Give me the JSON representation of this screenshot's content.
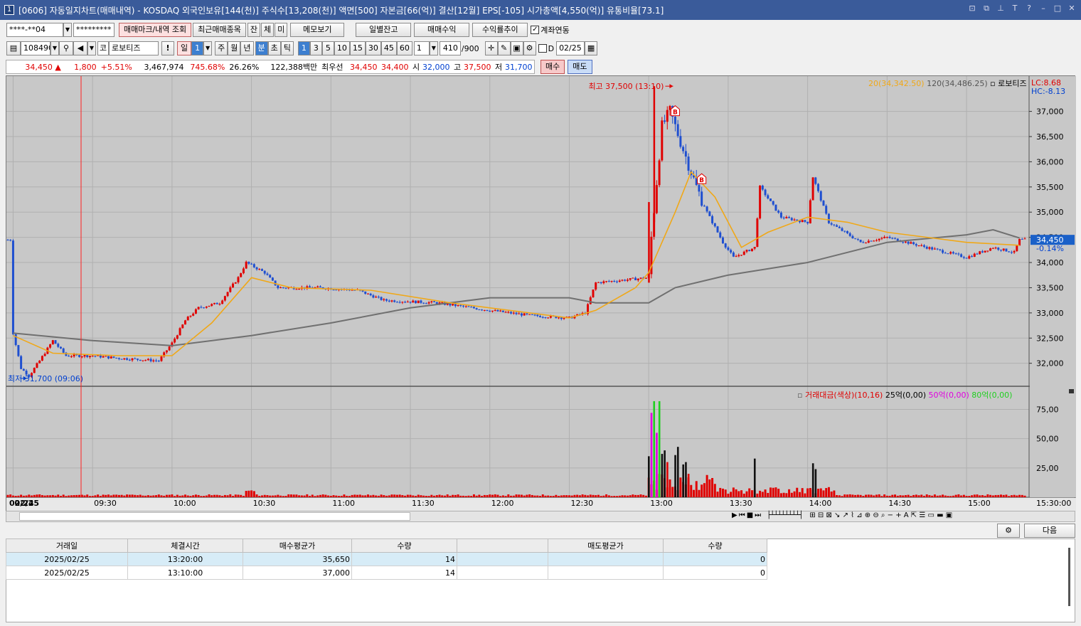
{
  "window": {
    "title": "[0606] 자동일지차트(매매내역) - KOSDAQ 외국인보유[144(천)] 주식수[13,208(천)] 액면[500] 자본금[66(억)] 결산[12월] EPS[-105] 시가총액[4,550(억)] 유통비율[73.1]",
    "app_number": "1"
  },
  "toolbar1": {
    "account": "****-**04",
    "password": "*********",
    "trade_mark_button": "매매마크/내역 조회",
    "recent_button": "최근매매종목",
    "jan": "잔",
    "che": "체",
    "mi": "미",
    "memo_button": "메모보기",
    "daily_balance_button": "일별잔고",
    "trade_profit_button": "매매수익",
    "profit_rate_button": "수익률추이",
    "account_link_label": "계좌연동"
  },
  "toolbar2": {
    "code": "108490",
    "name_prefix": "코",
    "name": "로보티즈",
    "excl": "!",
    "day": "일",
    "period_value": "1",
    "week": "주",
    "month": "월",
    "year": "년",
    "minute": "분",
    "second": "초",
    "tick": "틱",
    "intervals": [
      "1",
      "3",
      "5",
      "10",
      "15",
      "30",
      "45",
      "60"
    ],
    "interval_input": "1",
    "count": "410",
    "count_max": "/900",
    "d_label": "D",
    "date": "02/25"
  },
  "ticker": {
    "price": "34,450",
    "arrow": "▲",
    "change": "1,800",
    "change_pct": "+5.51%",
    "volume": "3,467,974",
    "volume_ratio": "745.68%",
    "turnover": "26.26%",
    "amount": "122,388백만",
    "best_label": "최우선",
    "best_ask": "34,450",
    "best_bid": "34,400",
    "open_label": "시",
    "open": "32,000",
    "high_label": "고",
    "high": "37,500",
    "low_label": "저",
    "low": "31,700",
    "buy_button": "매수",
    "sell_button": "매도"
  },
  "chart_data": [
    {
      "type": "candlestick",
      "title": "로보티즈",
      "legend": [
        "20(34,342.50)",
        "120(34,486.25)",
        "로보티즈"
      ],
      "corner_labels": [
        "LC:8.68",
        "HC:-8.13"
      ],
      "y_ticks": [
        "37,000",
        "36,500",
        "36,000",
        "35,500",
        "35,000",
        "34,500",
        "34,000",
        "33,500",
        "33,000",
        "32,500",
        "32,000"
      ],
      "ylim": [
        31700,
        37500
      ],
      "current_price_label": "34,450",
      "current_change_label": "-0.14%",
      "high_annotation": "최고 37,500 (13:10)",
      "low_annotation": "최저 31,700 (09:06)",
      "buy_markers": [
        "B",
        "B"
      ],
      "x_ticks": [
        "02/24",
        "02/25",
        "09:30",
        "10:00",
        "10:30",
        "11:00",
        "11:30",
        "12:00",
        "12:30",
        "13:00",
        "13:30",
        "14:00",
        "14:30",
        "15:00",
        "15:30:00"
      ],
      "price_path": [
        [
          "09:00",
          32600
        ],
        [
          "09:03",
          31900
        ],
        [
          "09:06",
          31750
        ],
        [
          "09:10",
          32050
        ],
        [
          "09:15",
          32450
        ],
        [
          "09:20",
          32150
        ],
        [
          "09:30",
          32150
        ],
        [
          "09:40",
          32100
        ],
        [
          "09:55",
          32050
        ],
        [
          "10:00",
          32400
        ],
        [
          "10:05",
          32850
        ],
        [
          "10:10",
          33100
        ],
        [
          "10:18",
          33200
        ],
        [
          "10:25",
          33700
        ],
        [
          "10:28",
          34000
        ],
        [
          "10:35",
          33800
        ],
        [
          "10:40",
          33500
        ],
        [
          "10:55",
          33500
        ],
        [
          "11:10",
          33450
        ],
        [
          "11:20",
          33250
        ],
        [
          "11:40",
          33200
        ],
        [
          "12:00",
          33050
        ],
        [
          "12:15",
          32950
        ],
        [
          "12:30",
          32900
        ],
        [
          "12:36",
          33000
        ],
        [
          "12:40",
          33600
        ],
        [
          "12:50",
          33650
        ],
        [
          "13:00",
          33700
        ],
        [
          "13:01",
          34500
        ],
        [
          "13:05",
          36700
        ],
        [
          "13:08",
          37000
        ],
        [
          "13:12",
          36400
        ],
        [
          "13:18",
          35500
        ],
        [
          "13:22",
          35000
        ],
        [
          "13:28",
          34400
        ],
        [
          "13:32",
          34100
        ],
        [
          "13:40",
          34300
        ],
        [
          "13:42",
          35500
        ],
        [
          "13:50",
          34900
        ],
        [
          "14:00",
          34800
        ],
        [
          "14:02",
          35700
        ],
        [
          "14:08",
          34800
        ],
        [
          "14:20",
          34400
        ],
        [
          "14:30",
          34500
        ],
        [
          "14:45",
          34300
        ],
        [
          "15:00",
          34100
        ],
        [
          "15:10",
          34300
        ],
        [
          "15:18",
          34200
        ],
        [
          "15:20",
          34450
        ]
      ],
      "ma20_path": [
        [
          "09:00",
          32550
        ],
        [
          "09:15",
          32200
        ],
        [
          "09:40",
          32150
        ],
        [
          "10:00",
          32150
        ],
        [
          "10:15",
          32800
        ],
        [
          "10:30",
          33700
        ],
        [
          "10:45",
          33500
        ],
        [
          "11:15",
          33450
        ],
        [
          "11:45",
          33200
        ],
        [
          "12:30",
          32900
        ],
        [
          "12:40",
          33050
        ],
        [
          "12:55",
          33500
        ],
        [
          "13:00",
          33800
        ],
        [
          "13:10",
          35000
        ],
        [
          "13:16",
          35800
        ],
        [
          "13:25",
          35300
        ],
        [
          "13:35",
          34300
        ],
        [
          "13:45",
          34600
        ],
        [
          "14:00",
          34900
        ],
        [
          "14:15",
          34800
        ],
        [
          "14:30",
          34600
        ],
        [
          "15:00",
          34400
        ],
        [
          "15:20",
          34342
        ]
      ],
      "ma120_path": [
        [
          "09:00",
          32600
        ],
        [
          "09:30",
          32450
        ],
        [
          "10:00",
          32350
        ],
        [
          "10:30",
          32550
        ],
        [
          "11:00",
          32800
        ],
        [
          "11:30",
          33100
        ],
        [
          "12:00",
          33300
        ],
        [
          "12:30",
          33300
        ],
        [
          "12:40",
          33200
        ],
        [
          "13:00",
          33200
        ],
        [
          "13:10",
          33500
        ],
        [
          "13:30",
          33750
        ],
        [
          "14:00",
          34000
        ],
        [
          "14:30",
          34400
        ],
        [
          "15:00",
          34550
        ],
        [
          "15:10",
          34650
        ],
        [
          "15:20",
          34486
        ]
      ]
    },
    {
      "type": "bar",
      "title": "거래대금(색상)(10,16)",
      "legend": [
        "거래대금(색상)(10,16)",
        "25억(0,00)",
        "50억(0,00)",
        "80억(0,00)"
      ],
      "y_ticks": [
        "75,00",
        "50,00",
        "25,00"
      ],
      "ylim": [
        0,
        85
      ],
      "spikes": [
        [
          "13:00",
          35,
          "#111111"
        ],
        [
          "13:01",
          72,
          "#e000e0"
        ],
        [
          "13:02",
          82,
          "#20d020"
        ],
        [
          "13:03",
          55,
          "#e000e0"
        ],
        [
          "13:04",
          82,
          "#20d020"
        ],
        [
          "13:05",
          37,
          "#111111"
        ],
        [
          "13:06",
          40,
          "#111111"
        ],
        [
          "13:07",
          30,
          "#e00000"
        ],
        [
          "13:10",
          36,
          "#111111"
        ],
        [
          "13:11",
          43,
          "#111111"
        ],
        [
          "13:13",
          28,
          "#111111"
        ],
        [
          "13:14",
          30,
          "#111111"
        ],
        [
          "13:15",
          20,
          "#e00000"
        ],
        [
          "13:40",
          33,
          "#111111"
        ],
        [
          "14:02",
          29,
          "#111111"
        ],
        [
          "14:03",
          24,
          "#111111"
        ]
      ]
    }
  ],
  "bottom": {
    "settings_icon": "gear-icon",
    "next_button": "다음"
  },
  "trade_table": {
    "headers": [
      "거래일",
      "체결시간",
      "매수평균가",
      "수량",
      "",
      "매도평균가",
      "수량"
    ],
    "rows": [
      [
        "2025/02/25",
        "13:20:00",
        "35,650",
        "14",
        "",
        "",
        "0"
      ],
      [
        "2025/02/25",
        "13:10:00",
        "37,000",
        "14",
        "",
        "",
        "0"
      ]
    ]
  },
  "colors": {
    "title_bar": "#3a5b9a",
    "chart_bg": "#c8c8c8",
    "up": "#e00000",
    "down": "#1f4fd0",
    "ma20": "#f0a818",
    "ma120": "#707070"
  }
}
